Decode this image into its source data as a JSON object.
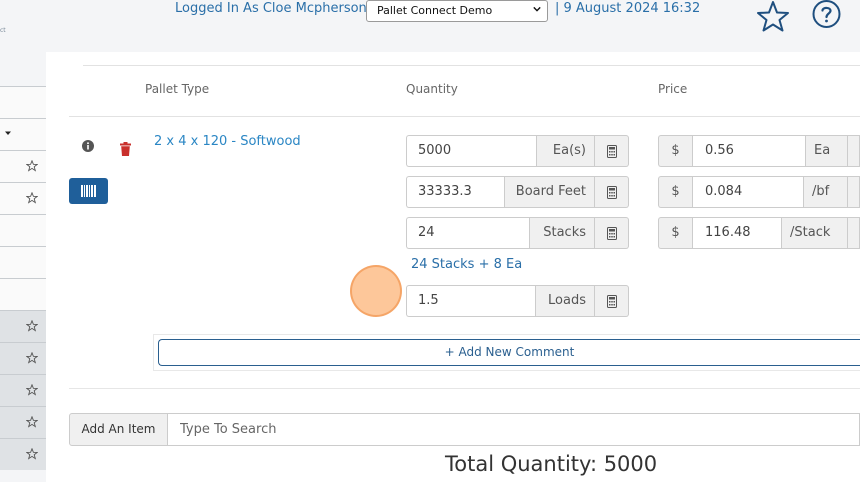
{
  "header": {
    "brand_fragment": "ct",
    "login_text": "Logged In As Cloe Mcpherson |",
    "org_select_value": "Pallet Connect Demo",
    "datetime": "| 9 August 2024 16:32",
    "icons": {
      "favorite": "star-icon",
      "help": "help-icon"
    }
  },
  "sidebar": {
    "icons": [
      "chevron-down-icon",
      "star-icon"
    ]
  },
  "table": {
    "headers": {
      "pallet_type": "Pallet Type",
      "quantity": "Quantity",
      "price": "Price"
    },
    "row": {
      "product": "2 x 4 x 120 - Softwood",
      "quantity": {
        "each": {
          "value": "5000",
          "unit": "Ea(s)"
        },
        "board_feet": {
          "value": "33333.3",
          "unit": "Board Feet"
        },
        "stacks": {
          "value": "24",
          "unit": "Stacks"
        },
        "stack_summary": "24 Stacks + 8 Ea",
        "loads": {
          "value": "1.5",
          "unit": "Loads"
        }
      },
      "price": {
        "currency": "$",
        "each": {
          "value": "0.56",
          "unit": "Ea"
        },
        "board_feet": {
          "value": "0.084",
          "unit": "/bf"
        },
        "stack": {
          "value": "116.48",
          "unit": "/Stack"
        }
      }
    }
  },
  "comment_button": "+ Add New Comment",
  "add_item": {
    "button": "Add An Item",
    "placeholder": "Type To Search"
  },
  "total_quantity": "Total Quantity: 5000",
  "colors": {
    "accent": "#2a6fa8",
    "link": "#2a86c4",
    "barcode_button": "#1f5f9a",
    "delete": "#c9302c",
    "cursor": "#fcb478"
  }
}
